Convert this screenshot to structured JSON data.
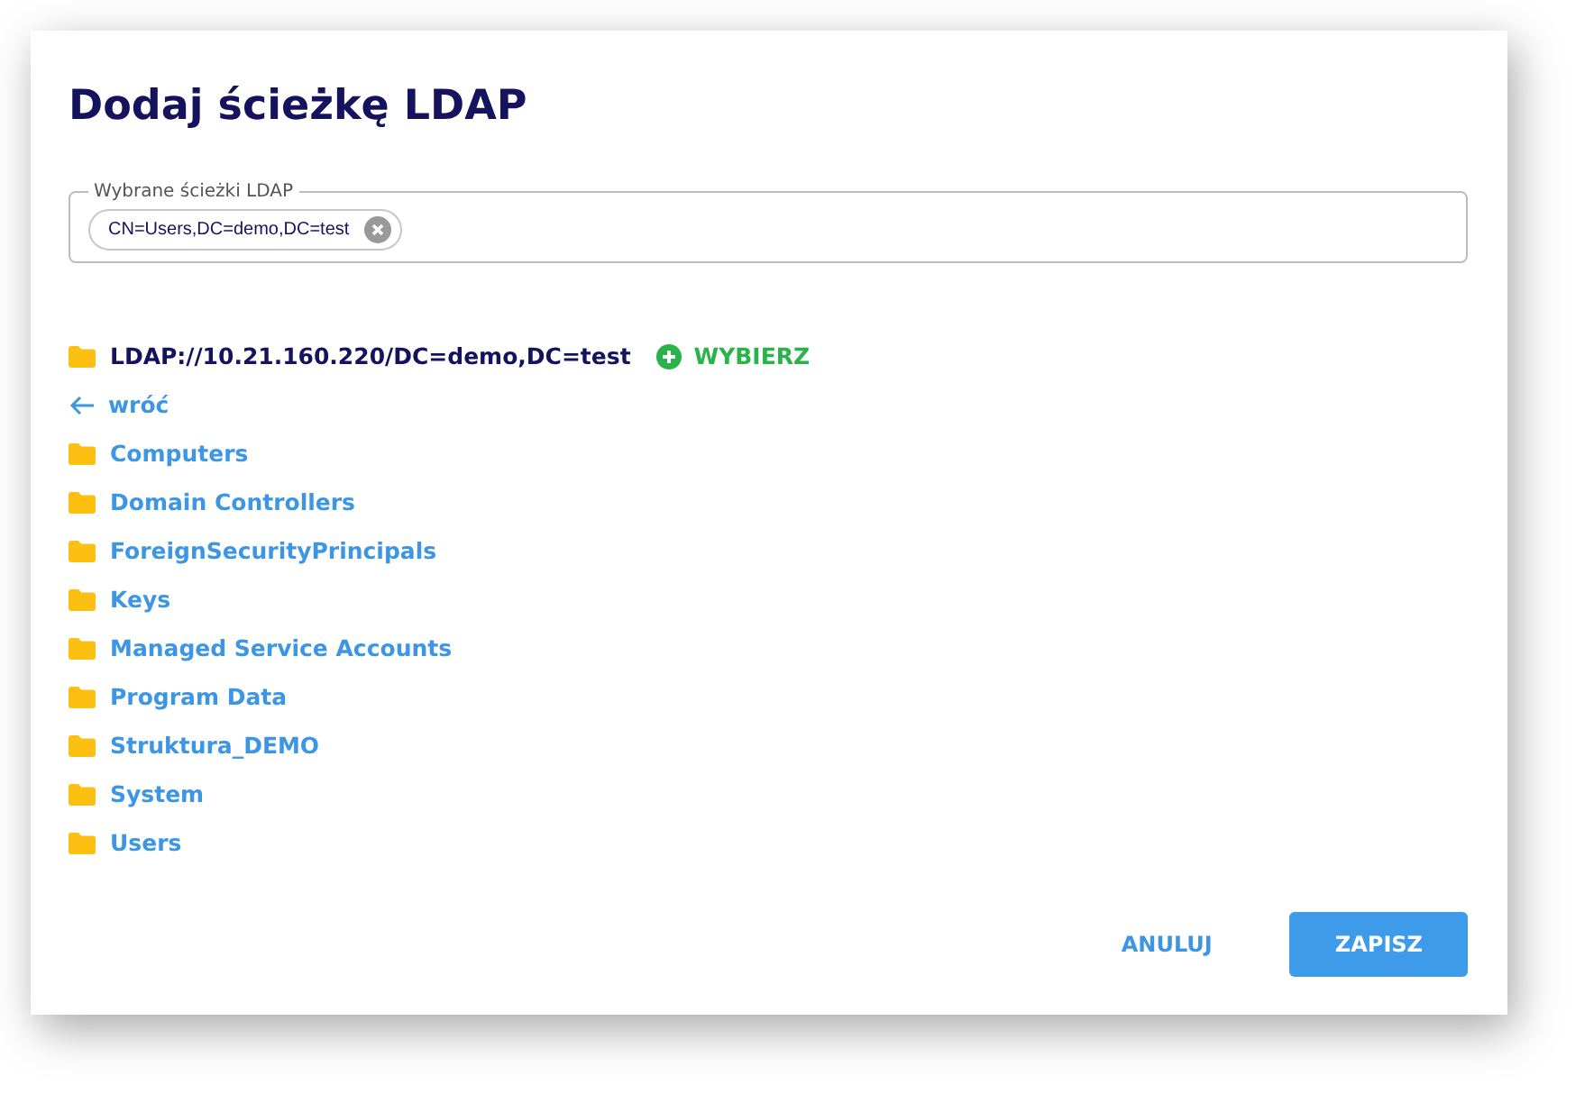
{
  "dialog": {
    "title": "Dodaj ścieżkę LDAP"
  },
  "selected_paths": {
    "label": "Wybrane ścieżki LDAP",
    "chips": [
      {
        "label": "CN=Users,DC=demo,DC=test"
      }
    ]
  },
  "current_path": {
    "label": "LDAP://10.21.160.220/DC=demo,DC=test",
    "action": "WYBIERZ"
  },
  "back": {
    "label": "wróć"
  },
  "folders": [
    {
      "label": "Computers"
    },
    {
      "label": "Domain Controllers"
    },
    {
      "label": "ForeignSecurityPrincipals"
    },
    {
      "label": "Keys"
    },
    {
      "label": "Managed Service Accounts"
    },
    {
      "label": "Program Data"
    },
    {
      "label": "Struktura_DEMO"
    },
    {
      "label": "System"
    },
    {
      "label": "Users"
    }
  ],
  "buttons": [
    {
      "label": "ANULUJ",
      "kind": "text"
    },
    {
      "label": "ZAPISZ",
      "kind": "primary"
    }
  ]
}
